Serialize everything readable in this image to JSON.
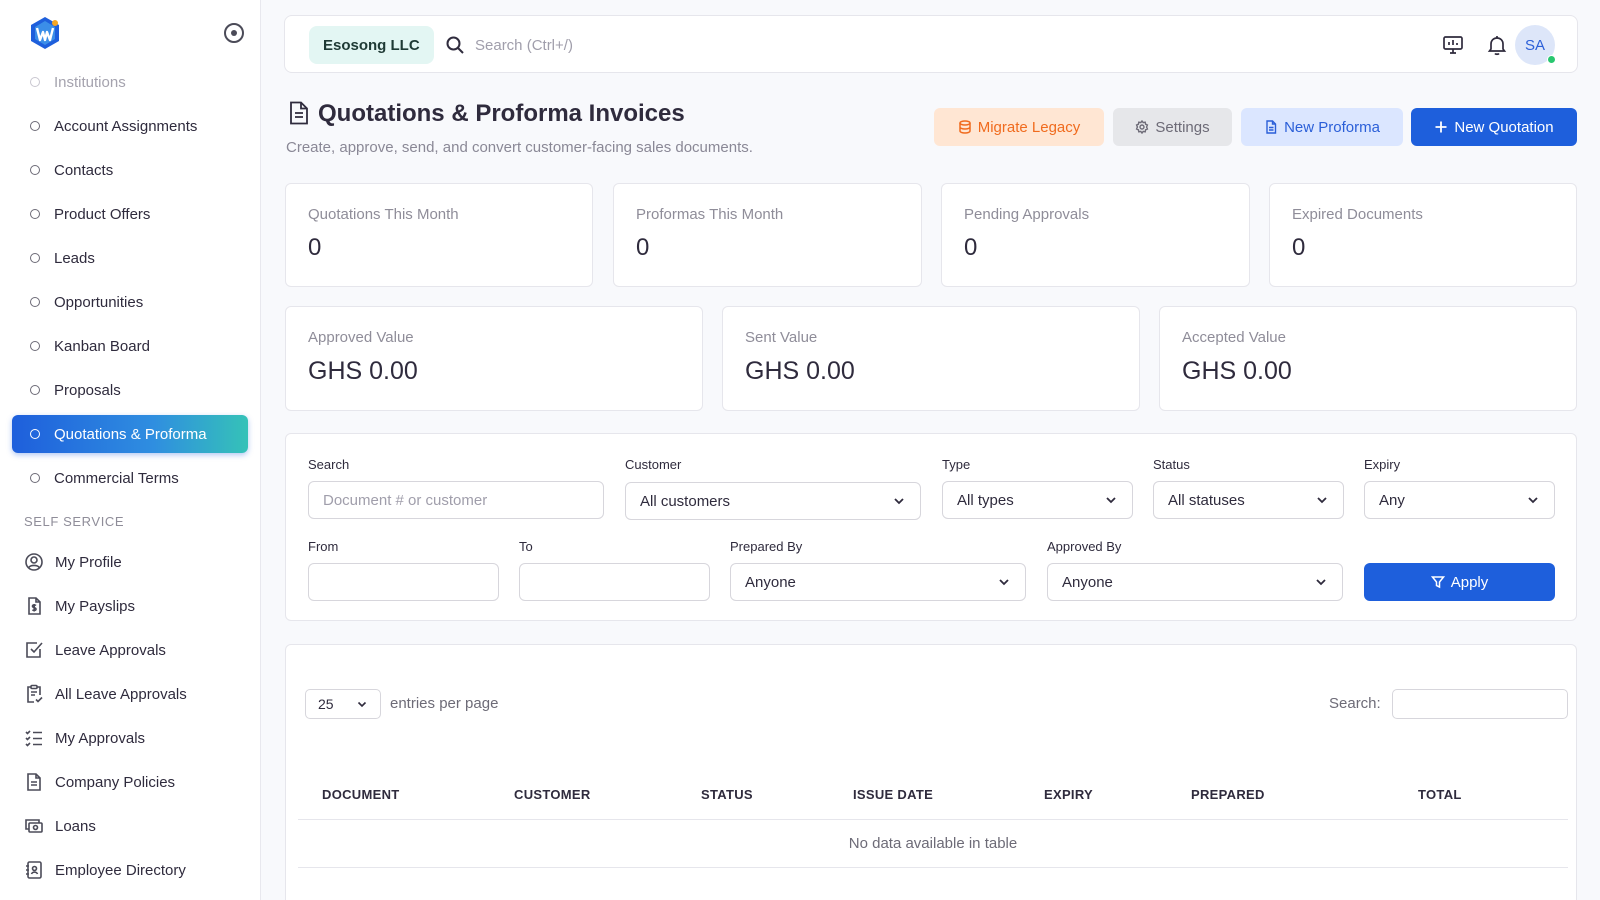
{
  "sidebar": {
    "items": [
      {
        "label": "Institutions"
      },
      {
        "label": "Account Assignments"
      },
      {
        "label": "Contacts"
      },
      {
        "label": "Product Offers"
      },
      {
        "label": "Leads"
      },
      {
        "label": "Opportunities"
      },
      {
        "label": "Kanban Board"
      },
      {
        "label": "Proposals"
      },
      {
        "label": "Quotations & Proforma"
      },
      {
        "label": "Commercial Terms"
      }
    ],
    "section_label": "SELF SERVICE",
    "self_service": [
      {
        "label": "My Profile",
        "icon": "user-circle-icon"
      },
      {
        "label": "My Payslips",
        "icon": "payslip-icon"
      },
      {
        "label": "Leave Approvals",
        "icon": "checkbox-icon"
      },
      {
        "label": "All Leave Approvals",
        "icon": "clipboard-icon"
      },
      {
        "label": "My Approvals",
        "icon": "checklist-icon"
      },
      {
        "label": "Company Policies",
        "icon": "document-icon"
      },
      {
        "label": "Loans",
        "icon": "cash-icon"
      },
      {
        "label": "Employee Directory",
        "icon": "address-book-icon"
      }
    ]
  },
  "topbar": {
    "company": "Esosong LLC",
    "search_placeholder": "Search (Ctrl+/)",
    "avatar_initials": "SA"
  },
  "header": {
    "title": "Quotations & Proforma Invoices",
    "subtitle": "Create, approve, send, and convert customer-facing sales documents.",
    "buttons": {
      "migrate": "Migrate Legacy",
      "settings": "Settings",
      "new_proforma": "New Proforma",
      "new_quotation": "New Quotation"
    }
  },
  "stats": [
    {
      "label": "Quotations This Month",
      "value": "0"
    },
    {
      "label": "Proformas This Month",
      "value": "0"
    },
    {
      "label": "Pending Approvals",
      "value": "0"
    },
    {
      "label": "Expired Documents",
      "value": "0"
    }
  ],
  "values": [
    {
      "label": "Approved Value",
      "value": "GHS 0.00"
    },
    {
      "label": "Sent Value",
      "value": "GHS 0.00"
    },
    {
      "label": "Accepted Value",
      "value": "GHS 0.00"
    }
  ],
  "filters": {
    "search_label": "Search",
    "search_placeholder": "Document # or customer",
    "customer_label": "Customer",
    "customer_value": "All customers",
    "type_label": "Type",
    "type_value": "All types",
    "status_label": "Status",
    "status_value": "All statuses",
    "expiry_label": "Expiry",
    "expiry_value": "Any",
    "from_label": "From",
    "to_label": "To",
    "prepared_label": "Prepared By",
    "prepared_value": "Anyone",
    "approved_label": "Approved By",
    "approved_value": "Anyone",
    "apply": "Apply"
  },
  "table": {
    "entries_value": "25",
    "entries_label": "entries per page",
    "search_label": "Search:",
    "columns": [
      "DOCUMENT",
      "CUSTOMER",
      "STATUS",
      "ISSUE DATE",
      "EXPIRY",
      "PREPARED",
      "TOTAL"
    ],
    "empty_text": "No data available in table"
  },
  "colors": {
    "primary": "#1e5fdc",
    "accent_teal": "#35c2b8",
    "migrate": "#f06b1e",
    "online": "#28c76f"
  }
}
